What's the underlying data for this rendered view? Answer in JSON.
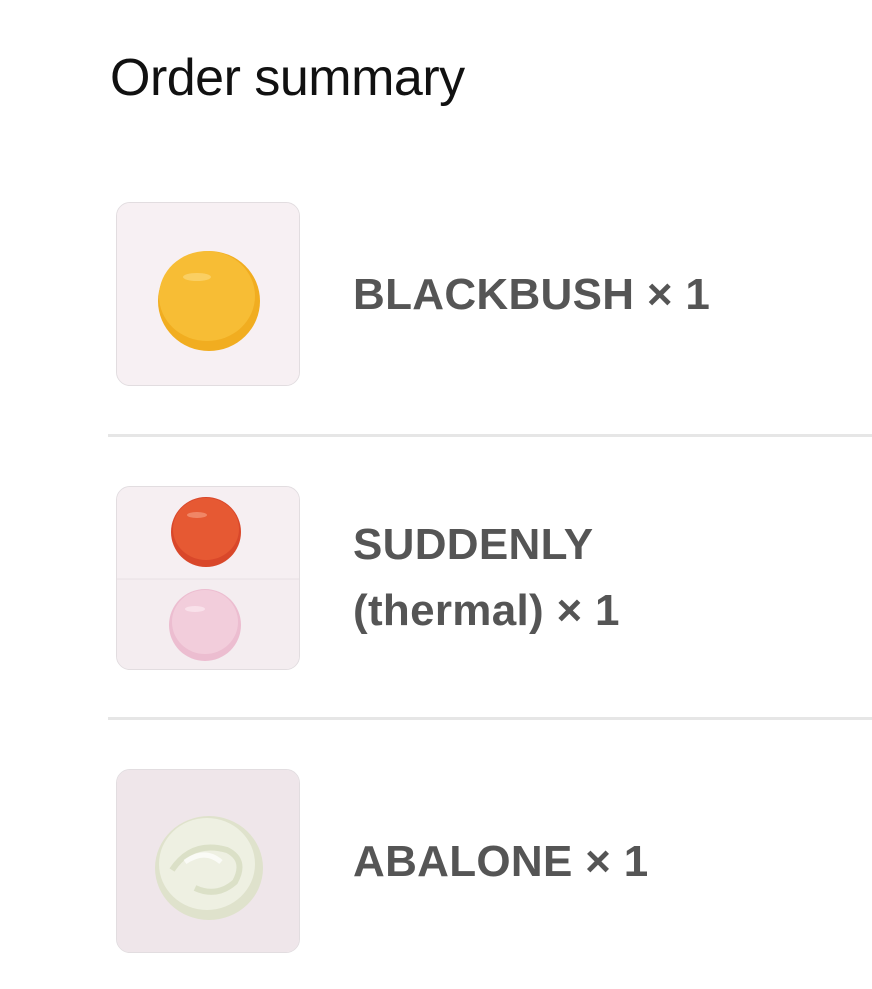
{
  "page": {
    "title": "Order summary"
  },
  "items": [
    {
      "label": "BLACKBUSH × 1",
      "thumbnail": "yellow-swatch-image",
      "swatch_color": "#f5b62a"
    },
    {
      "label": "SUDDENLY\n(thermal) × 1",
      "thumbnail": "orange-pink-swatch-image",
      "swatch_colors": [
        "#e2512b",
        "#f1c6d7"
      ]
    },
    {
      "label": "ABALONE × 1",
      "thumbnail": "pearl-swatch-image",
      "swatch_color": "#e7eadb"
    }
  ]
}
